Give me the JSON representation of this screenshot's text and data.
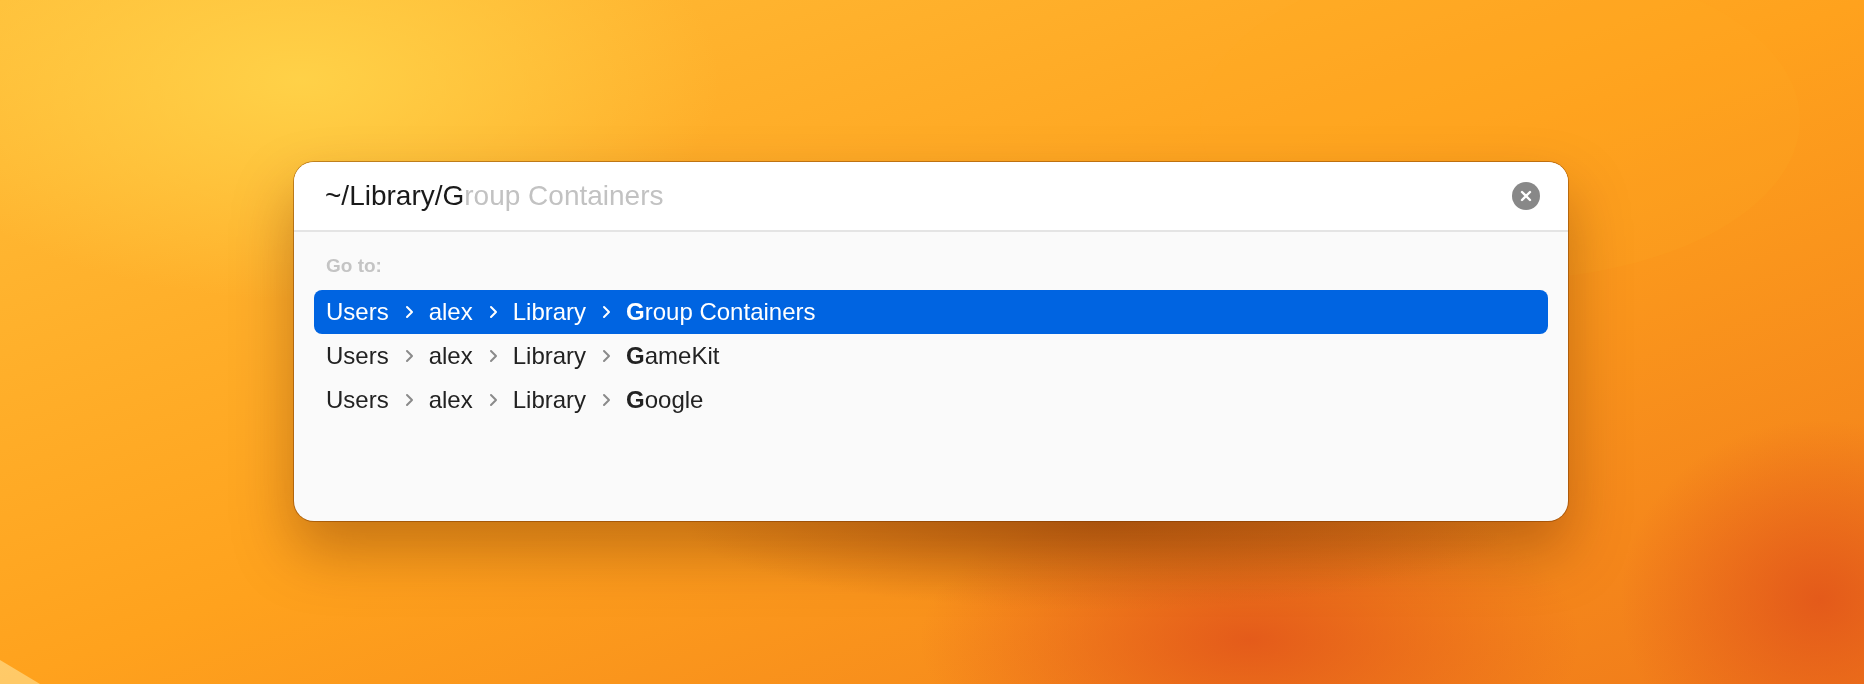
{
  "path_field": {
    "value": "~/Library/G",
    "completion": "roup Containers"
  },
  "section_label": "Go to:",
  "results": [
    {
      "segments": [
        "Users",
        "alex",
        "Library",
        "**G**roup Containers"
      ],
      "selected": true
    },
    {
      "segments": [
        "Users",
        "alex",
        "Library",
        "**G**ameKit"
      ],
      "selected": false
    },
    {
      "segments": [
        "Users",
        "alex",
        "Library",
        "**G**oogle"
      ],
      "selected": false
    }
  ]
}
